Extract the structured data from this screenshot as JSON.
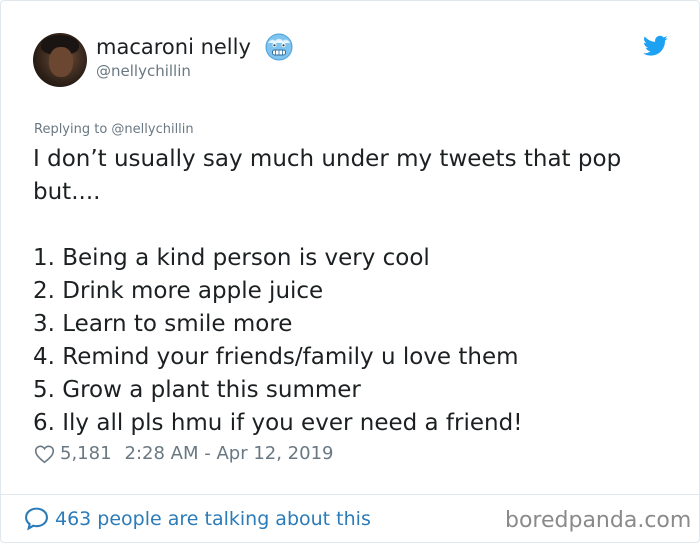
{
  "author": {
    "display_name": "macaroni nelly",
    "handle": "@nellychillin",
    "emoji_icon": "cold-face-emoji-icon"
  },
  "reply": {
    "replying_to": "Replying to @nellychillin"
  },
  "tweet": {
    "lines": [
      "I don’t usually say much under my tweets that pop",
      "but....",
      "1. Being a kind person is very cool",
      "2. Drink more apple juice",
      "3. Learn to smile more",
      "4. Remind your friends/family u love them",
      "5. Grow a plant this summer",
      "6. Ily all pls hmu if you ever need a friend!"
    ]
  },
  "meta": {
    "likes": "5,181",
    "timestamp": "2:28 AM - Apr 12, 2019"
  },
  "footer": {
    "talking_label": "463 people are talking about this",
    "watermark": "boredpanda.com"
  },
  "colors": {
    "twitter_blue": "#1da1f2",
    "link_blue": "#2b7bb9",
    "secondary_text": "#697882",
    "text": "#1c2022",
    "border": "#e1e8ed"
  }
}
